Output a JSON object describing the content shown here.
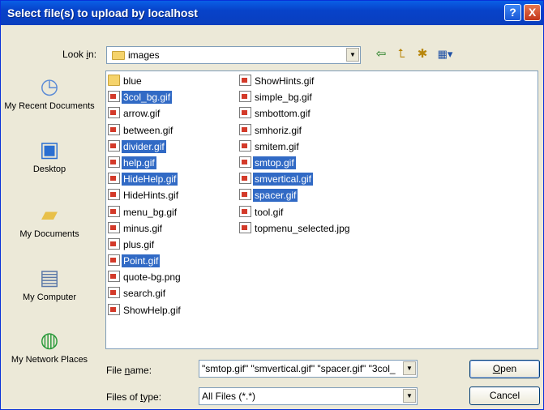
{
  "window": {
    "title": "Select file(s) to upload by localhost",
    "help_glyph": "?",
    "close_glyph": "X"
  },
  "toolbar": {
    "look_in_label_pre": "Look ",
    "look_in_label_key": "i",
    "look_in_label_post": "n:",
    "look_in_value": "images",
    "icons": [
      "back-icon",
      "up-folder-icon",
      "new-folder-icon",
      "view-menu-icon"
    ]
  },
  "places": [
    {
      "label": "My Recent Documents",
      "icon": "recent-documents-icon"
    },
    {
      "label": "Desktop",
      "icon": "desktop-icon"
    },
    {
      "label": "My Documents",
      "icon": "my-documents-icon"
    },
    {
      "label": "My Computer",
      "icon": "my-computer-icon"
    },
    {
      "label": "My Network Places",
      "icon": "network-places-icon"
    }
  ],
  "files": {
    "column1": [
      {
        "name": "blue",
        "type": "folder",
        "selected": false
      },
      {
        "name": "3col_bg.gif",
        "type": "file",
        "selected": true
      },
      {
        "name": "arrow.gif",
        "type": "file",
        "selected": false
      },
      {
        "name": "between.gif",
        "type": "file",
        "selected": false
      },
      {
        "name": "divider.gif",
        "type": "file",
        "selected": true
      },
      {
        "name": "help.gif",
        "type": "file",
        "selected": true
      },
      {
        "name": "HideHelp.gif",
        "type": "file",
        "selected": true
      },
      {
        "name": "HideHints.gif",
        "type": "file",
        "selected": false
      },
      {
        "name": "menu_bg.gif",
        "type": "file",
        "selected": false
      },
      {
        "name": "minus.gif",
        "type": "file",
        "selected": false
      },
      {
        "name": "plus.gif",
        "type": "file",
        "selected": false
      },
      {
        "name": "Point.gif",
        "type": "file",
        "selected": true
      },
      {
        "name": "quote-bg.png",
        "type": "file",
        "selected": false
      },
      {
        "name": "search.gif",
        "type": "file",
        "selected": false
      },
      {
        "name": "ShowHelp.gif",
        "type": "file",
        "selected": false
      }
    ],
    "column2": [
      {
        "name": "ShowHints.gif",
        "type": "file",
        "selected": false
      },
      {
        "name": "simple_bg.gif",
        "type": "file",
        "selected": false
      },
      {
        "name": "smbottom.gif",
        "type": "file",
        "selected": false
      },
      {
        "name": "smhoriz.gif",
        "type": "file",
        "selected": false
      },
      {
        "name": "smitem.gif",
        "type": "file",
        "selected": false
      },
      {
        "name": "smtop.gif",
        "type": "file",
        "selected": true
      },
      {
        "name": "smvertical.gif",
        "type": "file",
        "selected": true
      },
      {
        "name": "spacer.gif",
        "type": "file",
        "selected": true
      },
      {
        "name": "tool.gif",
        "type": "file",
        "selected": false
      },
      {
        "name": "topmenu_selected.jpg",
        "type": "file",
        "selected": false
      }
    ]
  },
  "form": {
    "file_name_label_pre": "File ",
    "file_name_label_key": "n",
    "file_name_label_post": "ame:",
    "file_name_value": "\"smtop.gif\" \"smvertical.gif\" \"spacer.gif\" \"3col_",
    "file_type_label_pre": "Files of ",
    "file_type_label_key": "t",
    "file_type_label_post": "ype:",
    "file_type_value": "All Files (*.*)"
  },
  "buttons": {
    "open_key": "O",
    "open_rest": "pen",
    "cancel": "Cancel"
  },
  "colors": {
    "title_bar": "#0a5fe6",
    "selection": "#316ac5",
    "dialog_bg": "#ece9d8"
  }
}
